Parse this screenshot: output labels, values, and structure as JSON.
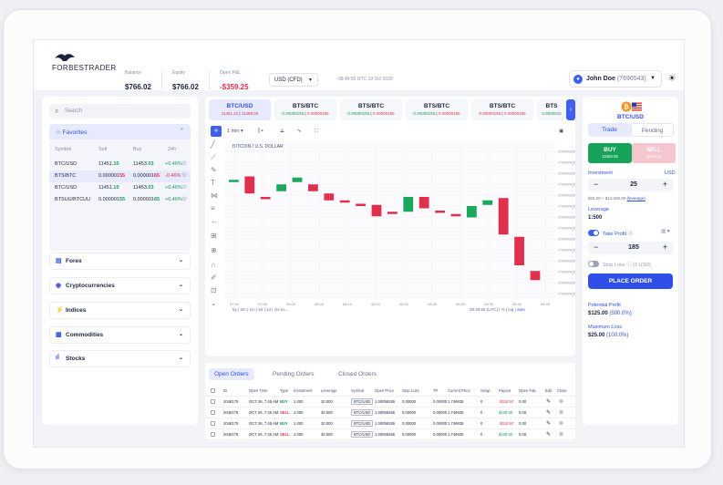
{
  "header": {
    "logo_text": "FORBESTRADER",
    "balance_label": "Balance",
    "balance_value": "$766.02",
    "equity_label": "Equity",
    "equity_value": "$766.02",
    "pnl_label": "Open P&L",
    "pnl_value": "-$359.25",
    "account_type": "USD (CFD)",
    "datetime": "08:49:55 UTC 19 Oct 2020",
    "user_name": "John Doe",
    "user_id": "(7696543)"
  },
  "sidebar": {
    "search_placeholder": "Search",
    "favorites_label": "Favorites",
    "columns": [
      "Symbol",
      "Sell",
      "Buy",
      "24h"
    ],
    "rows": [
      {
        "symbol": "BTC/USD",
        "sell_a": "11451.",
        "sell_b": "10",
        "buy_a": "11453.",
        "buy_b": "03",
        "change": "+0.46%",
        "dir": "up"
      },
      {
        "symbol": "BTS/BTC",
        "sell_a": "0.000001",
        "sell_b": "55",
        "buy_a": "0.000001",
        "buy_b": "65",
        "change": "-0.46%",
        "dir": "dn"
      },
      {
        "symbol": "BTC/USD",
        "sell_a": "11451.",
        "sell_b": "10",
        "buy_a": "11453.",
        "buy_b": "03",
        "change": "+0.46%",
        "dir": "up"
      },
      {
        "symbol": "BTSUU/BTCUU",
        "sell_a": "0.000001",
        "sell_b": "55",
        "buy_a": "0.000001",
        "buy_b": "65",
        "change": "+0.46%",
        "dir": "up"
      }
    ],
    "categories": [
      "Forex",
      "Cryptocurrencies",
      "Indices",
      "Commodities",
      "Stocks"
    ]
  },
  "tickers": [
    {
      "name": "BTC/USD",
      "bid": "11451.10",
      "ask": "11459.03",
      "active": true
    },
    {
      "name": "BTS/BTC",
      "bid": "0.00000155",
      "ask": "0.00000165",
      "active": false
    },
    {
      "name": "BTS/BTC",
      "bid": "0.00000155",
      "ask": "0.00000165",
      "active": false
    },
    {
      "name": "BTS/BTC",
      "bid": "0.00000155",
      "ask": "0.00000165",
      "active": false
    },
    {
      "name": "BTS/BTC",
      "bid": "0.00000155",
      "ask": "0.00000165",
      "active": false
    },
    {
      "name": "BTS",
      "bid": "0.0000015",
      "ask": "",
      "active": false
    }
  ],
  "chart_toolbar": {
    "interval": "1 min"
  },
  "chart": {
    "title": "BITCOIN / U.S. DOLLAR",
    "price_labels": [
      "0.00000165",
      "0.00000165",
      "0.00000165",
      "0.00000165",
      "0.00000165",
      "0.00000165",
      "0.00000165",
      "0.00000165",
      "0.00000165",
      "0.00000165",
      "0.00000165",
      "0.00000165",
      "0.00000165",
      "0.00000165"
    ],
    "time_labels": [
      "07:50",
      "07:55",
      "08:00",
      "08:05",
      "08:10",
      "08:15",
      "08:20",
      "08:25",
      "08:30",
      "08:35",
      "08:40",
      "08:45"
    ],
    "ranges": [
      "5y",
      "3m",
      "1m",
      "5d",
      "1d",
      "Go to..."
    ],
    "bottom_right": [
      "08:49:55 (UTC)",
      "%",
      "log",
      "auto"
    ]
  },
  "orders": {
    "tabs": [
      "Open Orders",
      "Pending Orders",
      "Closed Orders"
    ],
    "columns": [
      "ID",
      "Open Time",
      "Type",
      "Investment",
      "Leverage",
      "Symbol",
      "Open Price",
      "Stop Loss",
      "TP",
      "Current Price",
      "Swap",
      "Payout",
      "Open P&L",
      "Edit",
      "Close"
    ],
    "rows": [
      {
        "id": "2048179",
        "time": "OCT 26, 7:45 AM",
        "type": "BUY",
        "inv": "1.000",
        "lev": "30.000",
        "sym": "BTC/USD",
        "open": "1.00056265",
        "sl": "0.00000",
        "tp": "0.00000",
        "cur": "1.749635",
        "swap": "0",
        "payout": "-$118.50",
        "pnl": "0.00"
      },
      {
        "id": "2048179",
        "time": "OCT 26, 7:45 AM",
        "type": "SELL",
        "inv": "1.000",
        "lev": "30.000",
        "sym": "BTC/USD",
        "open": "1.00056265",
        "sl": "0.00000",
        "tp": "0.00000",
        "cur": "1.749635",
        "swap": "0",
        "payout": "$139.50",
        "pnl": "0.00"
      },
      {
        "id": "2048179",
        "time": "OCT 26, 7:45 AM",
        "type": "BUY",
        "inv": "1.000",
        "lev": "30.000",
        "sym": "BTC/USD",
        "open": "1.00056265",
        "sl": "0.00000",
        "tp": "0.00000",
        "cur": "1.749635",
        "swap": "0",
        "payout": "-$118.50",
        "pnl": "0.00"
      },
      {
        "id": "2048179",
        "time": "OCT 26, 7:45 AM",
        "type": "SELL",
        "inv": "1.000",
        "lev": "30.000",
        "sym": "BTC/USD",
        "open": "1.00056265",
        "sl": "0.00000",
        "tp": "0.00000",
        "cur": "1.749635",
        "swap": "0",
        "payout": "$139.50",
        "pnl": "0.00"
      },
      {
        "id": "2048179",
        "time": "OCT 26, 7:45 AM",
        "type": "SELL",
        "inv": "1.000",
        "lev": "30.000",
        "sym": "BTC/USD",
        "open": "1.00056265",
        "sl": "0.00000",
        "tp": "0.00000",
        "cur": "1.749635",
        "swap": "0",
        "payout": "$139.50",
        "pnl": "0.00"
      }
    ]
  },
  "trade_panel": {
    "symbol": "BTC/USD",
    "tab_trade": "Trade",
    "tab_pending": "Pending",
    "buy_label": "BUY",
    "buy_price": "11503.06",
    "sell_label": "SELL",
    "sell_price": "11501.11",
    "investment_label": "Investment",
    "currency": "USD",
    "investment_value": "25",
    "investment_range": "$25.00 ÷ $12,500.00",
    "leverage_link": "(leverage)",
    "leverage_label": "Leverage",
    "leverage_value": "1:500",
    "take_profit_label": "Take Profit",
    "take_profit_value": "185",
    "stop_loss_label": "Stop Loss",
    "stop_loss_note": "(3 USD)",
    "place_order": "PLACE ORDER",
    "potential_profit_label": "Potential Profit",
    "potential_profit_value": "$125.00",
    "potential_profit_pct": "(500.0%)",
    "max_loss_label": "Maximum Loss",
    "max_loss_value": "$25.00",
    "max_loss_pct": "(100.0%)"
  },
  "chart_data": {
    "type": "candlestick",
    "title": "BITCOIN / U.S. DOLLAR",
    "x": [
      "07:50",
      "07:52",
      "07:54",
      "07:56",
      "07:58",
      "08:00",
      "08:02",
      "08:04",
      "08:06",
      "08:08",
      "08:10",
      "08:12",
      "08:14",
      "08:16",
      "08:18",
      "08:20",
      "08:22",
      "08:24",
      "08:26",
      "08:28",
      "08:30",
      "08:32",
      "08:34",
      "08:36",
      "08:38"
    ],
    "candles": [
      {
        "o": 0.6,
        "c": 0.6,
        "dir": "up"
      },
      {
        "o": 0.63,
        "c": 0.48,
        "dir": "dn"
      },
      {
        "o": 0.45,
        "c": 0.45,
        "dir": "dn"
      },
      {
        "o": 0.5,
        "c": 0.56,
        "dir": "up"
      },
      {
        "o": 0.58,
        "c": 0.62,
        "dir": "up"
      },
      {
        "o": 0.56,
        "c": 0.5,
        "dir": "dn"
      },
      {
        "o": 0.48,
        "c": 0.42,
        "dir": "dn"
      },
      {
        "o": 0.42,
        "c": 0.41,
        "dir": "dn"
      },
      {
        "o": 0.39,
        "c": 0.38,
        "dir": "dn"
      },
      {
        "o": 0.38,
        "c": 0.28,
        "dir": "dn"
      },
      {
        "o": 0.32,
        "c": 0.3,
        "dir": "dn"
      },
      {
        "o": 0.32,
        "c": 0.45,
        "dir": "up"
      },
      {
        "o": 0.45,
        "c": 0.35,
        "dir": "dn"
      },
      {
        "o": 0.33,
        "c": 0.32,
        "dir": "dn"
      },
      {
        "o": 0.3,
        "c": 0.3,
        "dir": "dn"
      },
      {
        "o": 0.27,
        "c": 0.37,
        "dir": "up"
      },
      {
        "o": 0.38,
        "c": 0.42,
        "dir": "up"
      },
      {
        "o": 0.44,
        "c": 0.12,
        "dir": "dn"
      },
      {
        "o": 0.1,
        "c": -0.15,
        "dir": "dn"
      },
      {
        "o": -0.2,
        "c": -0.28,
        "dir": "dn"
      }
    ]
  }
}
